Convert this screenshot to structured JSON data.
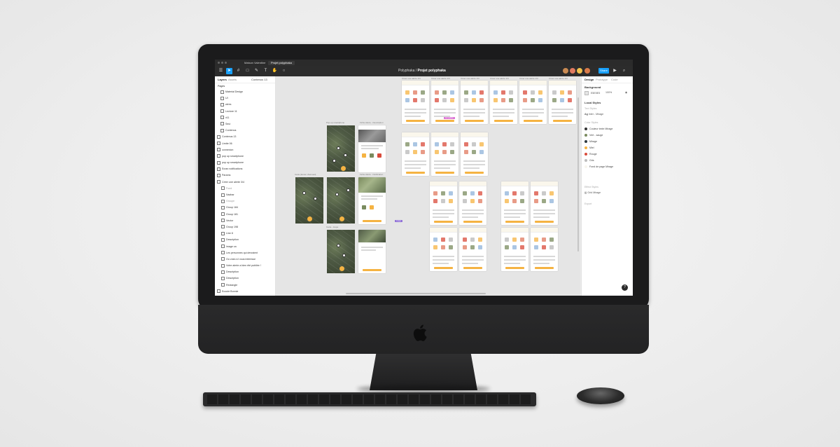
{
  "window": {
    "tabs": [
      {
        "label": "Maison Valentine",
        "active": false
      },
      {
        "label": "Projet polyphaka",
        "active": true
      }
    ],
    "document_path_prefix": "Polyphaka",
    "document_title": "Projet polyphaka"
  },
  "toolbar": {
    "tools": [
      "menu-icon",
      "move-icon",
      "frame-icon",
      "shape-icon",
      "pen-icon",
      "text-icon",
      "hand-icon",
      "comment-icon"
    ],
    "share_label": "Share"
  },
  "left_panel": {
    "tabs": [
      "Layers",
      "Assets"
    ],
    "page_selector": "Contenus 13",
    "section_label": "Pages",
    "layers": [
      {
        "label": "Material Design",
        "muted": false
      },
      {
        "label": "UI",
        "muted": false
      },
      {
        "label": "wires",
        "muted": false
      },
      {
        "label": "Lecture 11",
        "muted": false
      },
      {
        "label": "v11",
        "muted": false
      },
      {
        "label": "Seui",
        "muted": false
      },
      {
        "label": "Contenus",
        "muted": false
      },
      {
        "label": "Contenus 13",
        "muted": false
      },
      {
        "label": "Limite 06",
        "muted": false
      },
      {
        "label": "connexion",
        "muted": false
      },
      {
        "label": "pop up smartphone",
        "muted": false
      },
      {
        "label": "pop up smartphone",
        "muted": false
      },
      {
        "label": "Ecran notifications",
        "muted": false
      },
      {
        "label": "Params",
        "muted": false
      },
      {
        "label": "Créer une alerte 3/4",
        "muted": false
      },
      {
        "label": "Fond",
        "muted": true
      },
      {
        "label": "Navbar",
        "muted": false
      },
      {
        "label": "Groupe",
        "muted": true
      },
      {
        "label": "Group 184",
        "muted": false
      },
      {
        "label": "Group 181",
        "muted": false
      },
      {
        "label": "Vector",
        "muted": false
      },
      {
        "label": "Group 198",
        "muted": false
      },
      {
        "label": "Line 8",
        "muted": false
      },
      {
        "label": "Description",
        "muted": false
      },
      {
        "label": "image ca",
        "muted": false
      },
      {
        "label": "Les personnes qui devraient",
        "muted": false
      },
      {
        "label": "Ou voici-t-il vous intéresse",
        "muted": false
      },
      {
        "label": "Votre alerte a bien été publiée !",
        "muted": false
      },
      {
        "label": "Description",
        "muted": false
      },
      {
        "label": "Description",
        "muted": false
      },
      {
        "label": "Rectangle",
        "muted": false
      },
      {
        "label": "Ecoute Bonnie",
        "muted": false
      },
      {
        "label": "Fond",
        "muted": true
      }
    ]
  },
  "right_panel": {
    "tabs": [
      "Design",
      "Prototype",
      "Code"
    ],
    "background_label": "Background",
    "background_hex": "E5E5E5",
    "background_opacity": "100%",
    "local_styles_label": "Local Styles",
    "text_styles_label": "Text Styles",
    "text_style_item": "Inter - Mirage",
    "color_styles_label": "Color Styles",
    "color_styles": [
      {
        "name": "Couleur texte Mirage",
        "color": "#333333"
      },
      {
        "name": "Vert - sauge",
        "color": "#7a8b5e"
      },
      {
        "name": "Mirage",
        "color": "#2f3a40"
      },
      {
        "name": "Miel",
        "color": "#f5b342"
      },
      {
        "name": "Rouge",
        "color": "#d94b3b"
      },
      {
        "name": "Gris",
        "color": "#bdbdbd"
      },
      {
        "name": "Fond de page Mirage",
        "color": "#f7f5ee"
      }
    ],
    "effect_styles_label": "Effect Styles",
    "effect_style_item": "Grid Mirage",
    "export_label": "Export",
    "help_label": "?"
  },
  "canvas": {
    "frame_labels": {
      "alerte": "Créer une alerte 1/3",
      "carte": "Carte (Ecran d'accueil)",
      "popup": "Pop up smartphone",
      "detail": "Fiche Alerte - Description",
      "notif": "Fiche Alerte - Notification",
      "loupe": "Carte - loupe"
    },
    "selection_badges": [
      "Loupe",
      "Annotation"
    ]
  },
  "colors": {
    "accent": "#18a0fb",
    "honey": "#f5b342",
    "bezel": "#1b1b1c"
  }
}
